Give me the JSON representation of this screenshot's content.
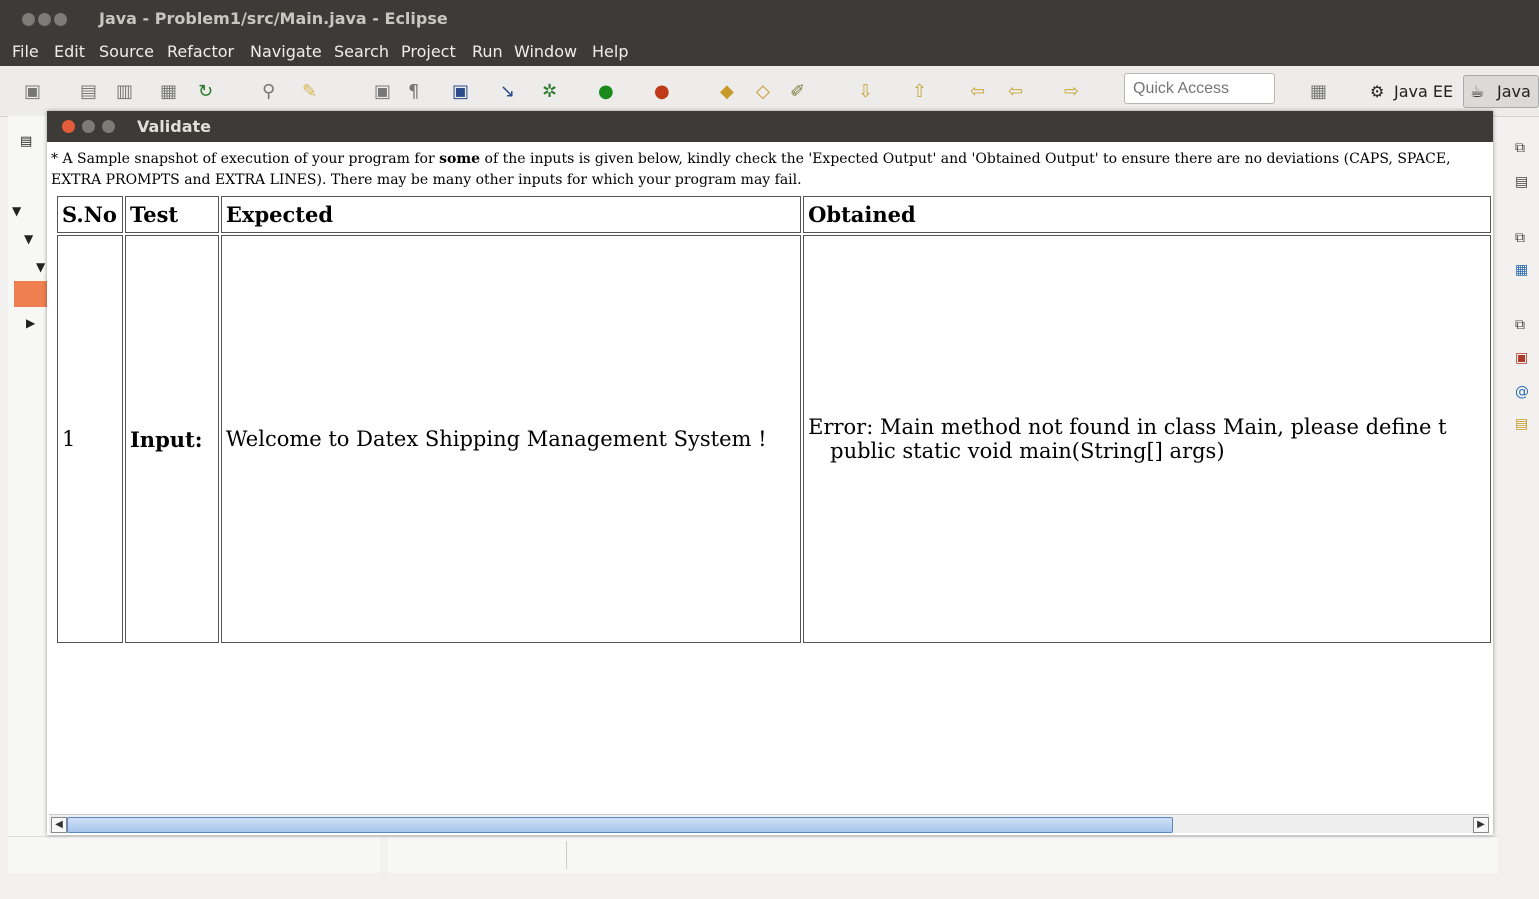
{
  "window": {
    "title": "Java - Problem1/src/Main.java - Eclipse"
  },
  "menu": [
    "File",
    "Edit",
    "Source",
    "Refactor",
    "Navigate",
    "Search",
    "Project",
    "Run",
    "Window",
    "Help"
  ],
  "toolbar": {
    "quick_access_placeholder": "Quick Access",
    "perspectives": [
      "Java EE",
      "Java"
    ]
  },
  "dialog": {
    "title": "Validate",
    "note_prefix": "* A Sample snapshot of execution of your program for ",
    "note_bold": "some",
    "note_suffix": " of the inputs is given below, kindly check the 'Expected Output' and 'Obtained Output' to ensure there are no deviations (CAPS, SPACE, EXTRA PROMPTS and EXTRA LINES). There may be many other inputs for which your program may fail.",
    "table": {
      "headers": [
        "S.No",
        "Test",
        "Expected",
        "Obtained"
      ],
      "rows": [
        {
          "sno": "1",
          "test": "Input:",
          "expected": "Welcome to Datex Shipping Management System !",
          "obtained_line1": "Error: Main method not found in class Main, please define t",
          "obtained_line2": "public static void main(String[] args)"
        }
      ]
    }
  },
  "colors": {
    "titlebar": "#3c3b37",
    "close": "#e35d3a",
    "accent_orange": "#f07f50"
  }
}
